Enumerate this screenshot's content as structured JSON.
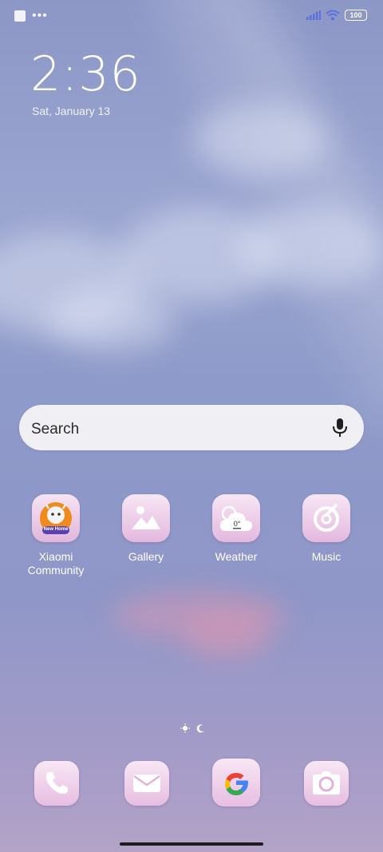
{
  "status_bar": {
    "battery": "100"
  },
  "clock": {
    "time": "2:36",
    "date": "Sat, January 13"
  },
  "search": {
    "label": "Search"
  },
  "apps": [
    {
      "label": "Xiaomi Community",
      "badge_text": "New Home",
      "icon": "xiaomi-community-icon"
    },
    {
      "label": "Gallery",
      "icon": "gallery-icon"
    },
    {
      "label": "Weather",
      "icon": "weather-icon",
      "temperature": "0°"
    },
    {
      "label": "Music",
      "icon": "music-icon"
    }
  ],
  "dock": [
    {
      "icon": "phone-icon"
    },
    {
      "icon": "mail-icon"
    },
    {
      "icon": "google-icon"
    },
    {
      "icon": "camera-icon"
    }
  ],
  "colors": {
    "icon_pink": "#e4b8de",
    "icon_glyph": "#ffffff",
    "search_bg": "#f3f3f6"
  }
}
